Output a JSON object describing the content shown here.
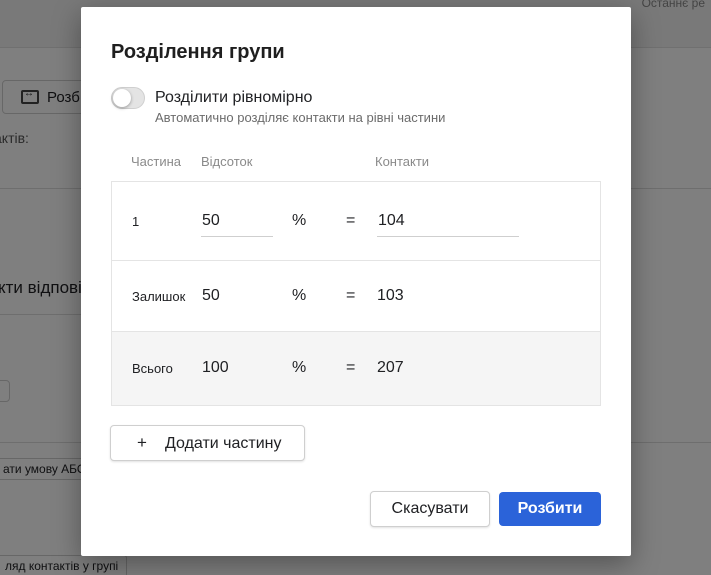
{
  "background": {
    "top_right_text": "Останнє ре",
    "split_button_label": "Розб",
    "contacts_label": "актів:",
    "section_heading": "кти відповід",
    "condition_button_label": "ати умову АБО",
    "view_button_label": "ляд контактів у групі"
  },
  "dialog": {
    "title": "Розділення групи",
    "toggle": {
      "label": "Розділити рівномірно",
      "description": "Автоматично розділяє контакти на рівні частини",
      "checked": false
    },
    "columns": {
      "part": "Частина",
      "percent": "Відсоток",
      "contacts": "Контакти"
    },
    "rows": [
      {
        "part": "1",
        "percent": "50",
        "percent_sign": "%",
        "equals": "=",
        "contacts": "104",
        "editable": true
      },
      {
        "part": "Залишок",
        "percent": "50",
        "percent_sign": "%",
        "equals": "=",
        "contacts": "103",
        "editable": false
      },
      {
        "part": "Всього",
        "percent": "100",
        "percent_sign": "%",
        "equals": "=",
        "contacts": "207",
        "editable": false
      }
    ],
    "add_part_button": {
      "icon": "plus-icon",
      "label": "Додати частину"
    },
    "cancel_button": "Скасувати",
    "split_button": "Розбити"
  },
  "colors": {
    "primary": "#2b63d9",
    "overlay": "rgba(0,0,0,0.5)",
    "total_row_bg": "#f5f5f5"
  }
}
